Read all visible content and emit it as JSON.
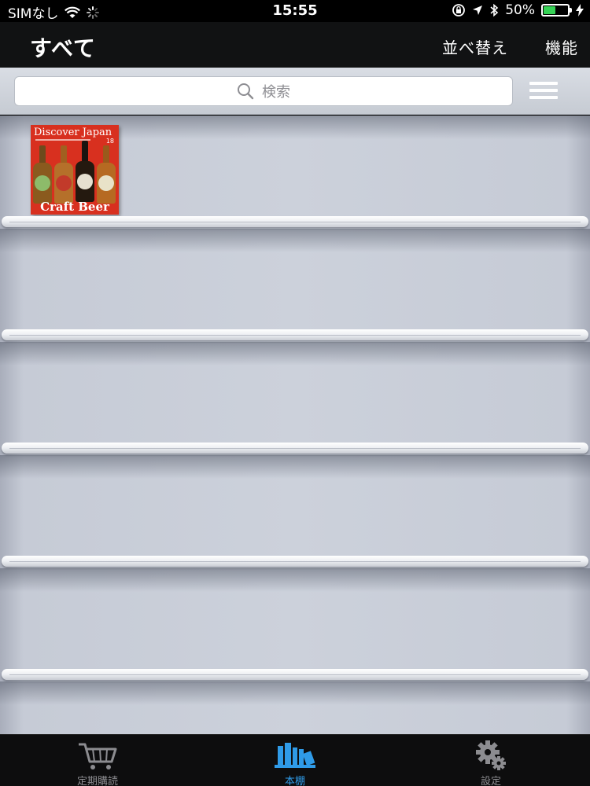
{
  "status_bar": {
    "carrier": "SIMなし",
    "time": "15:55",
    "battery_percent": "50%",
    "battery_level": 0.5,
    "battery_color": "#35d255",
    "icons": [
      "wifi-icon",
      "loading-spinner-icon",
      "rotation-lock-icon",
      "location-arrow-icon",
      "bluetooth-icon",
      "battery-icon",
      "charging-bolt-icon"
    ]
  },
  "nav": {
    "title": "すべて",
    "sort_label": "並べ替え",
    "function_label": "機能"
  },
  "search": {
    "placeholder": "検索",
    "icon": "search-icon",
    "menu_icon": "hamburger-menu-icon"
  },
  "bookshelf": {
    "shelf_count": 5,
    "books": [
      {
        "cover_title": "Discover Japan",
        "cover_volume": "18",
        "cover_caption": "Craft Beer",
        "cover_color": "#d8301f"
      }
    ]
  },
  "tab_bar": {
    "active_color": "#2f9be8",
    "tabs": [
      {
        "label": "定期購読",
        "icon": "shopping-cart-icon",
        "active": false
      },
      {
        "label": "本棚",
        "icon": "bookshelf-icon",
        "active": true
      },
      {
        "label": "設定",
        "icon": "gears-icon",
        "active": false
      }
    ]
  }
}
